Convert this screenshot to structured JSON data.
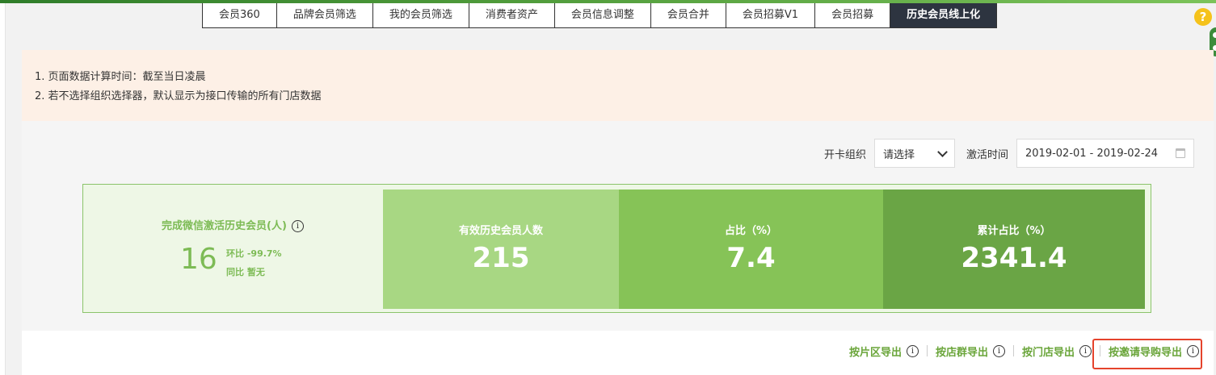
{
  "tabs": [
    {
      "label": "会员360",
      "active": false
    },
    {
      "label": "品牌会员筛选",
      "active": false
    },
    {
      "label": "我的会员筛选",
      "active": false
    },
    {
      "label": "消费者资产",
      "active": false
    },
    {
      "label": "会员信息调整",
      "active": false
    },
    {
      "label": "会员合并",
      "active": false
    },
    {
      "label": "会员招募V1",
      "active": false
    },
    {
      "label": "会员招募",
      "active": false
    },
    {
      "label": "历史会员线上化",
      "active": true
    }
  ],
  "help_badge": "?",
  "notice": {
    "line1": "1. 页面数据计算时间：截至当日凌晨",
    "line2": "2. 若不选择组织选择器，默认显示为接口传输的所有门店数据"
  },
  "filters": {
    "org_label": "开卡组织",
    "org_value": "请选择",
    "date_label": "激活时间",
    "date_value": "2019-02-01 - 2019-02-24"
  },
  "stats": {
    "first": {
      "title": "完成微信激活历史会员(人)",
      "value": "16",
      "mom_label": "环比",
      "mom_value": "-99.7%",
      "yoy_label": "同比",
      "yoy_value": "暂无"
    },
    "blocks": [
      {
        "label": "有效历史会员人数",
        "value": "215"
      },
      {
        "label": "占比（%）",
        "value": "7.4"
      },
      {
        "label": "累计占比（%）",
        "value": "2341.4"
      }
    ]
  },
  "exports": [
    {
      "label": "按片区导出"
    },
    {
      "label": "按店群导出"
    },
    {
      "label": "按门店导出"
    },
    {
      "label": "按邀请导购导出"
    }
  ],
  "info_glyph": "i",
  "colors": {
    "accent_green": "#7dbb55",
    "active_tab_bg": "#2d3440",
    "highlight_red": "#e5432c"
  }
}
